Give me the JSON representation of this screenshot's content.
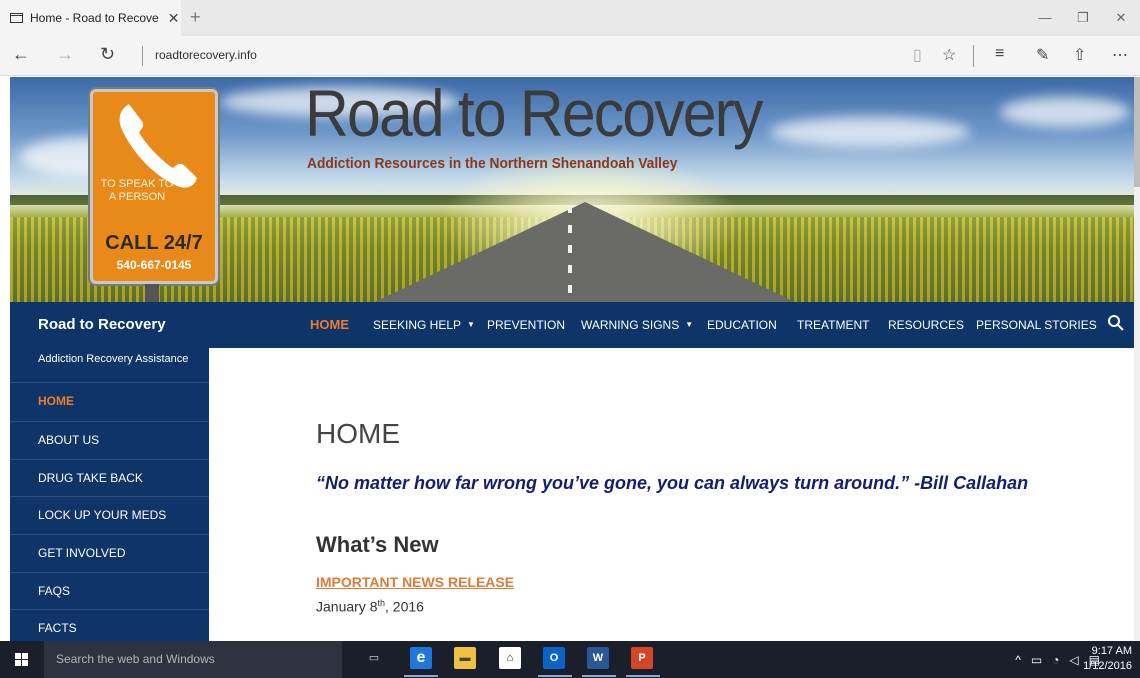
{
  "browser": {
    "tab_title": "Home - Road to Recove",
    "tab_close": "✕",
    "new_tab": "+",
    "url": "roadtorecovery.info",
    "icons": [
      "back-arrow-icon",
      "forward-arrow-icon",
      "refresh-icon",
      "reading-view-icon",
      "favorite-star-icon",
      "hub-icon",
      "web-note-icon",
      "share-icon",
      "more-icon"
    ]
  },
  "banner": {
    "title": "Road to Recovery",
    "tagline": "Addiction Resources in the Northern Shenandoah Valley",
    "sign_speak": "TO SPEAK TO A PERSON",
    "sign_call": "CALL 24/7",
    "sign_phone": "540-667-0145"
  },
  "nav": {
    "brand": "Road to Recovery",
    "items": [
      {
        "label": "HOME",
        "active": true
      },
      {
        "label": "SEEKING HELP",
        "dropdown": true
      },
      {
        "label": "PREVENTION"
      },
      {
        "label": "WARNING SIGNS",
        "dropdown": true
      },
      {
        "label": "EDUCATION"
      },
      {
        "label": "TREATMENT"
      },
      {
        "label": "RESOURCES"
      },
      {
        "label": "PERSONAL STORIES"
      }
    ]
  },
  "sidebar": {
    "subtitle": "Addiction Recovery Assistance",
    "items": [
      {
        "label": "HOME",
        "active": true
      },
      {
        "label": "ABOUT US"
      },
      {
        "label": "DRUG TAKE BACK"
      },
      {
        "label": "LOCK UP YOUR MEDS"
      },
      {
        "label": "GET INVOLVED"
      },
      {
        "label": "FAQS"
      },
      {
        "label": "FACTS"
      }
    ]
  },
  "main": {
    "heading": "HOME",
    "quote": "“No matter how far wrong you’ve gone, you can always turn around.” -Bill Callahan",
    "whats_new": "What’s New",
    "news_link": "IMPORTANT NEWS RELEASE",
    "news_date_prefix": "January 8",
    "news_date_sup": "th",
    "news_date_suffix": ", 2016"
  },
  "taskbar": {
    "search_placeholder": "Search the web and Windows",
    "time": "9:17 AM",
    "date": "1/12/2016",
    "colors": {
      "edge": "#1e78d7",
      "outlook": "#0a64c8",
      "word": "#2b5797",
      "powerpoint": "#d24726",
      "explorer": "#f0c040"
    }
  }
}
